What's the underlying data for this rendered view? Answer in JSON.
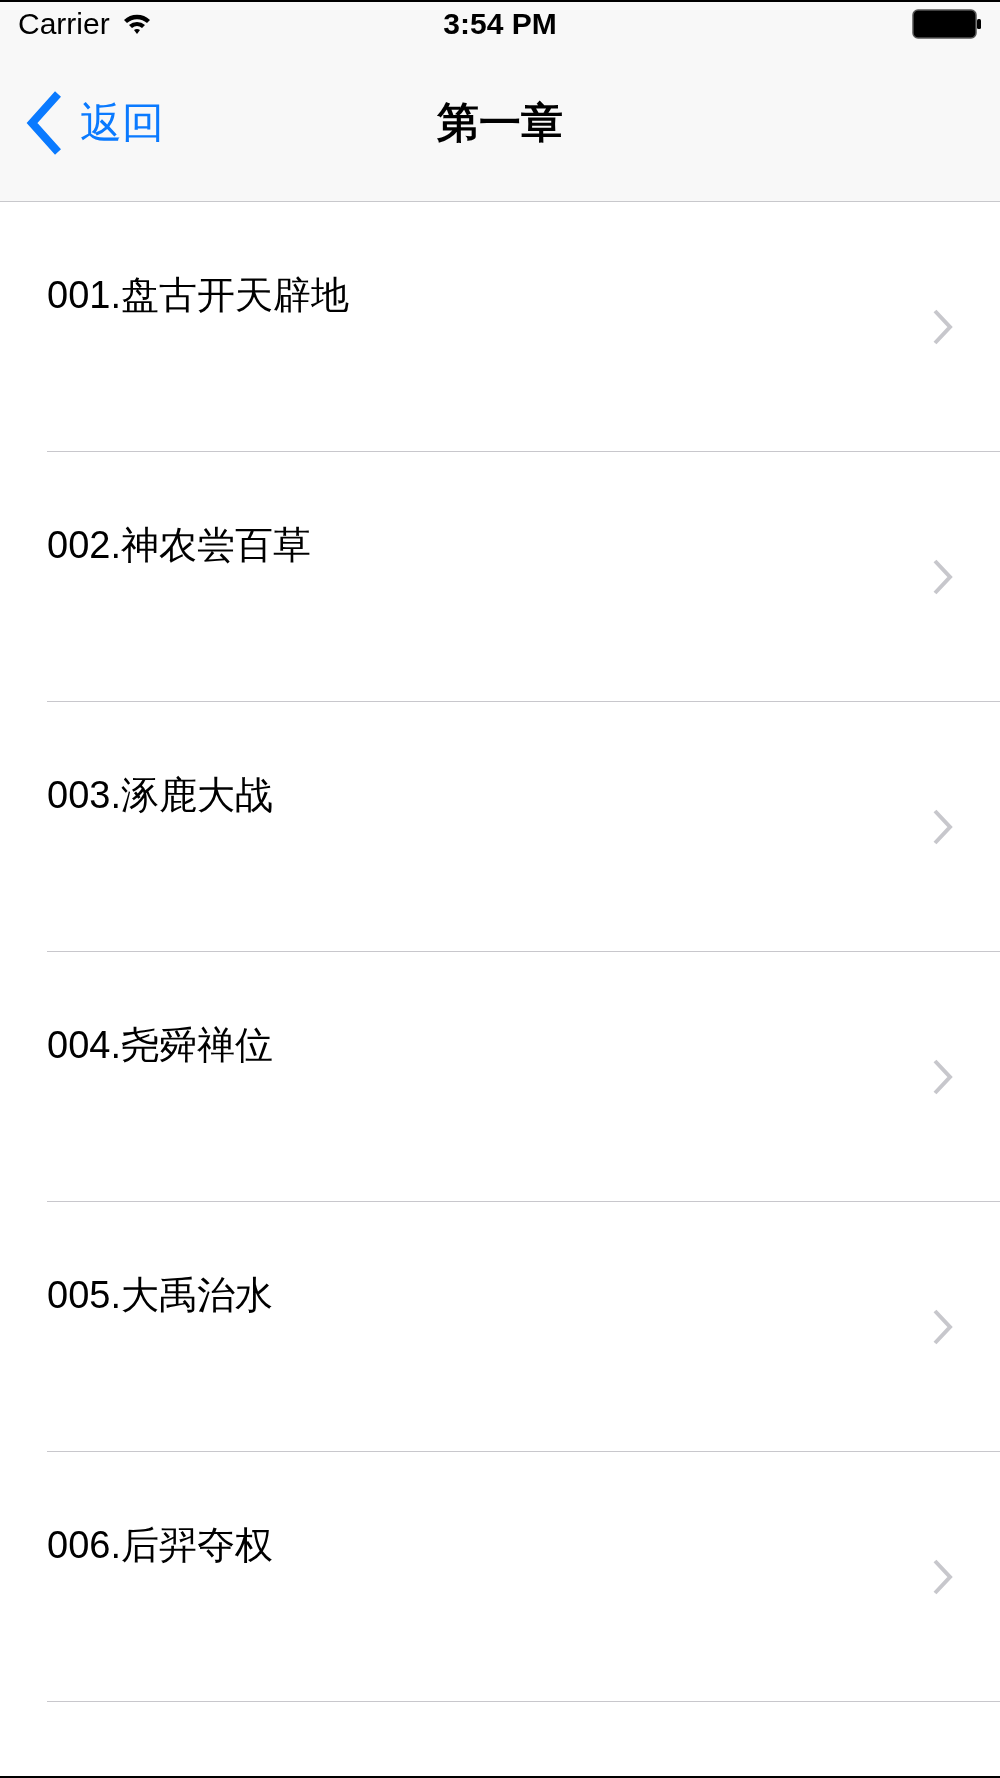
{
  "status_bar": {
    "carrier": "Carrier",
    "time": "3:54 PM"
  },
  "nav_bar": {
    "back": "返回",
    "title": "第一章"
  },
  "rows": [
    {
      "label": "001.盘古开天辟地"
    },
    {
      "label": "002.神农尝百草"
    },
    {
      "label": "003.涿鹿大战"
    },
    {
      "label": "004.尧舜禅位"
    },
    {
      "label": "005.大禹治水"
    },
    {
      "label": "006.后羿夺权"
    }
  ]
}
